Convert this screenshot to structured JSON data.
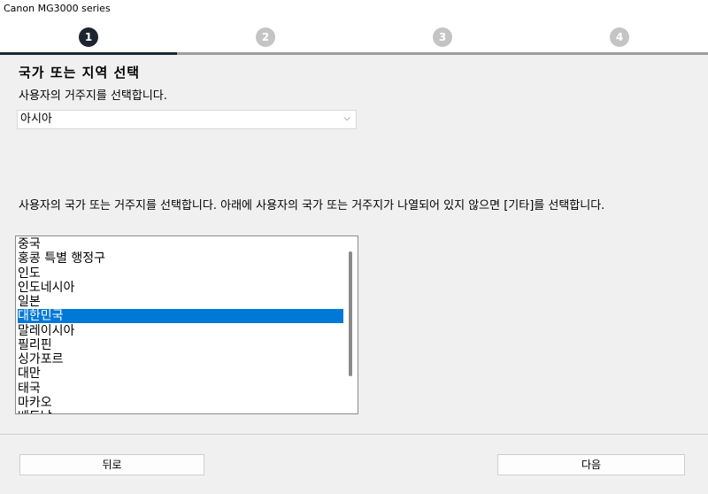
{
  "window": {
    "title": "Canon MG3000 series"
  },
  "steps": [
    "1",
    "2",
    "3",
    "4"
  ],
  "main": {
    "heading": "국가 또는 지역 선택",
    "subheading": "사용자의 거주지를 선택합니다.",
    "region_select": {
      "value": "아시아"
    },
    "description": "사용자의 국가 또는 거주지를 선택합니다. 아래에 사용자의 국가 또는 거주지가 나열되어 있지 않으면 [기타]를 선택합니다.",
    "country_list": {
      "items": [
        "중국",
        "홍콩 특별 행정구",
        "인도",
        "인도네시아",
        "일본",
        "대한민국",
        "말레이시아",
        "필리핀",
        "싱가포르",
        "대만",
        "태국",
        "마카오",
        "베트남"
      ],
      "selected": "대한민국"
    }
  },
  "footer": {
    "back_label": "뒤로",
    "next_label": "다음"
  },
  "colors": {
    "accent": "#0078d7",
    "step_active": "#1d2630",
    "step_inactive": "#c4c4c4"
  }
}
